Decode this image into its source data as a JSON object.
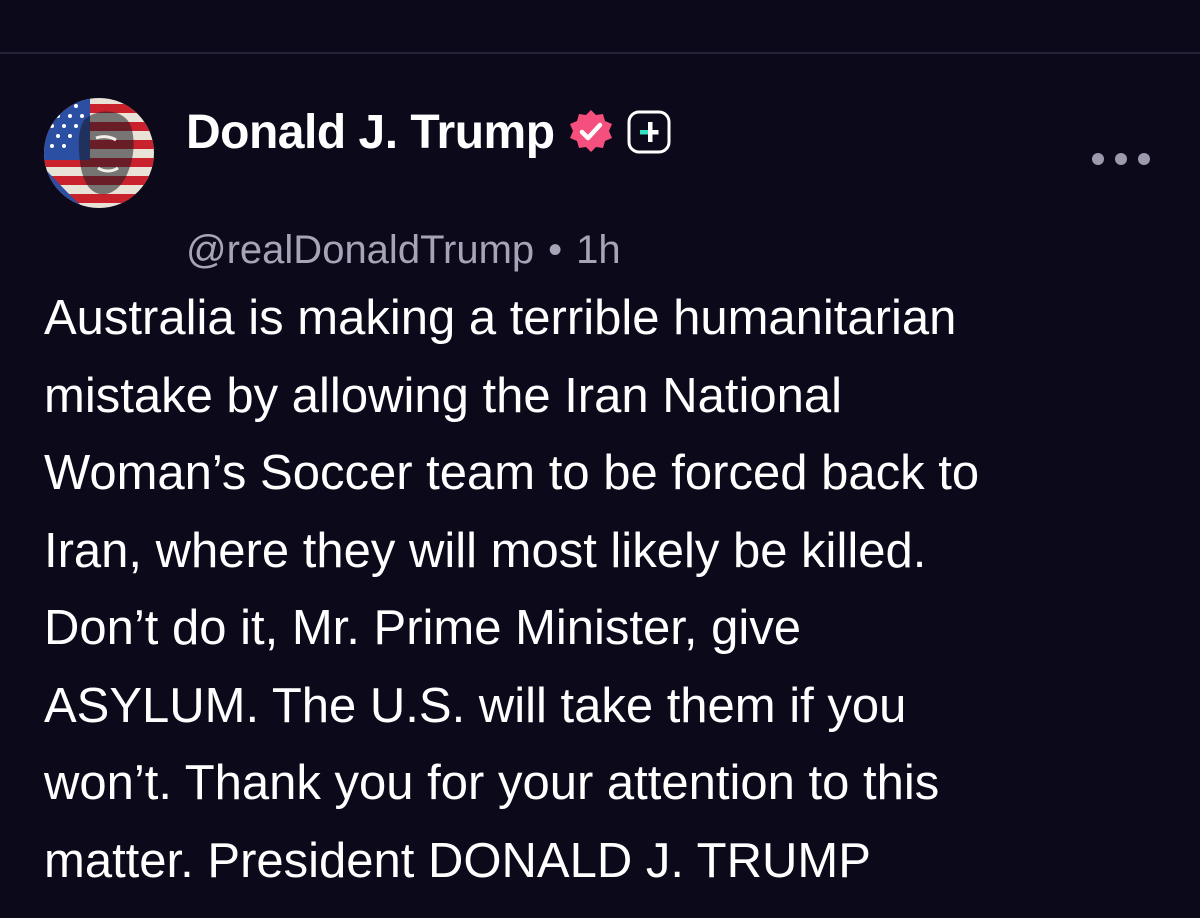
{
  "post": {
    "author": {
      "display_name": "Donald J. Trump",
      "handle": "@realDonaldTrump",
      "verified_icon": "verified-badge-icon",
      "plus_icon": "plus-badge-icon",
      "avatar_icon": "avatar-image"
    },
    "separator": "•",
    "time": "1h",
    "more_icon": "more-options-icon",
    "body_lines": [
      "Australia is making a terrible humanitarian",
      "mistake by allowing the Iran National",
      "Woman’s Soccer team to be forced back to",
      "Iran, where they will most likely be killed.",
      "Don’t do it, Mr. Prime Minister, give",
      "ASYLUM. The U.S. will take them if you",
      "won’t. Thank you for your attention to this",
      "matter. President DONALD J. TRUMP"
    ]
  },
  "colors": {
    "background": "#0c0a1a",
    "text": "#ffffff",
    "muted": "#a6a4b6",
    "verified": "#f44f7d",
    "plus_accent": "#35e3c2",
    "divider": "#25233a"
  }
}
